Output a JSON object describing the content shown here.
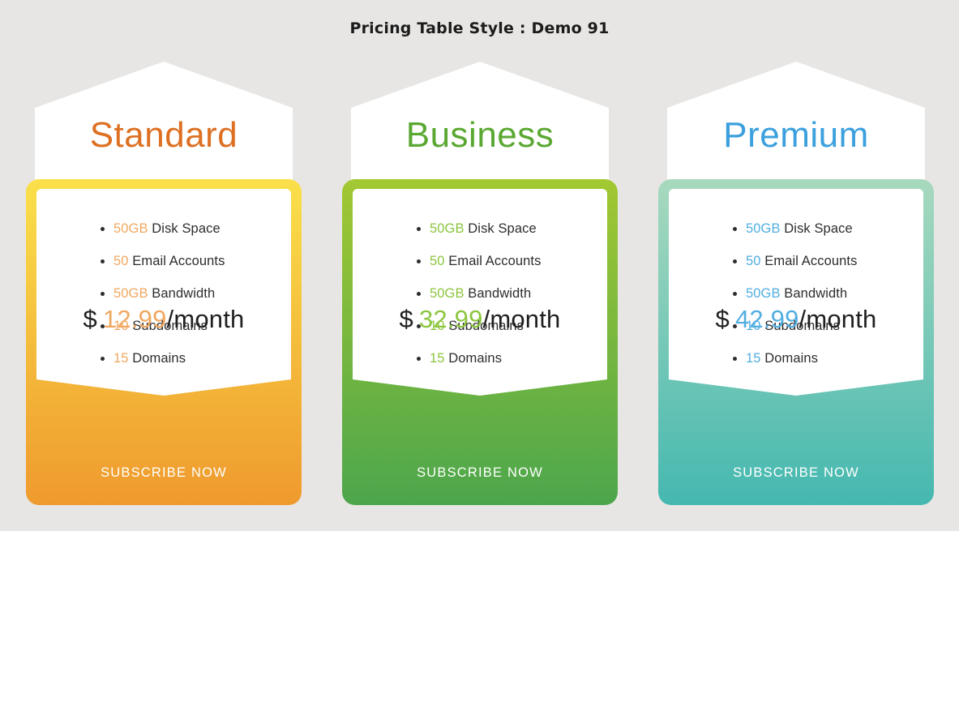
{
  "page": {
    "title": "Pricing Table Style : Demo 91",
    "background": "#e8e6e4",
    "canvas_background": "#ffffff"
  },
  "plans": [
    {
      "name": "Standard",
      "title_color": "#dd7023",
      "accent_color": "#f0a860",
      "frame_gradient_from": "#fae04a",
      "frame_gradient_to": "#ef9a2e",
      "features": [
        {
          "value": "50GB",
          "label": "Disk Space"
        },
        {
          "value": "50",
          "label": "Email Accounts"
        },
        {
          "value": "50GB",
          "label": "Bandwidth"
        },
        {
          "value": "10",
          "label": "Subdomains"
        },
        {
          "value": "15",
          "label": "Domains"
        }
      ],
      "price": {
        "currency": "$",
        "amount": "12.99",
        "period": "/month"
      },
      "cta": "SUBSCRIBE NOW"
    },
    {
      "name": "Business",
      "title_color": "#5aa832",
      "accent_color": "#8cc63f",
      "frame_gradient_from": "#a3c832",
      "frame_gradient_to": "#4ca64c",
      "features": [
        {
          "value": "50GB",
          "label": "Disk Space"
        },
        {
          "value": "50",
          "label": "Email Accounts"
        },
        {
          "value": "50GB",
          "label": "Bandwidth"
        },
        {
          "value": "10",
          "label": "Subdomains"
        },
        {
          "value": "15",
          "label": "Domains"
        }
      ],
      "price": {
        "currency": "$",
        "amount": "32.99",
        "period": "/month"
      },
      "cta": "SUBSCRIBE NOW"
    },
    {
      "name": "Premium",
      "title_color": "#3ba0dd",
      "accent_color": "#52aee0",
      "frame_gradient_from": "#a8d9be",
      "frame_gradient_to": "#45b8b0",
      "features": [
        {
          "value": "50GB",
          "label": "Disk Space"
        },
        {
          "value": "50",
          "label": "Email Accounts"
        },
        {
          "value": "50GB",
          "label": "Bandwidth"
        },
        {
          "value": "10",
          "label": "Subdomains"
        },
        {
          "value": "15",
          "label": "Domains"
        }
      ],
      "price": {
        "currency": "$",
        "amount": "42.99",
        "period": "/month"
      },
      "cta": "SUBSCRIBE NOW"
    }
  ]
}
